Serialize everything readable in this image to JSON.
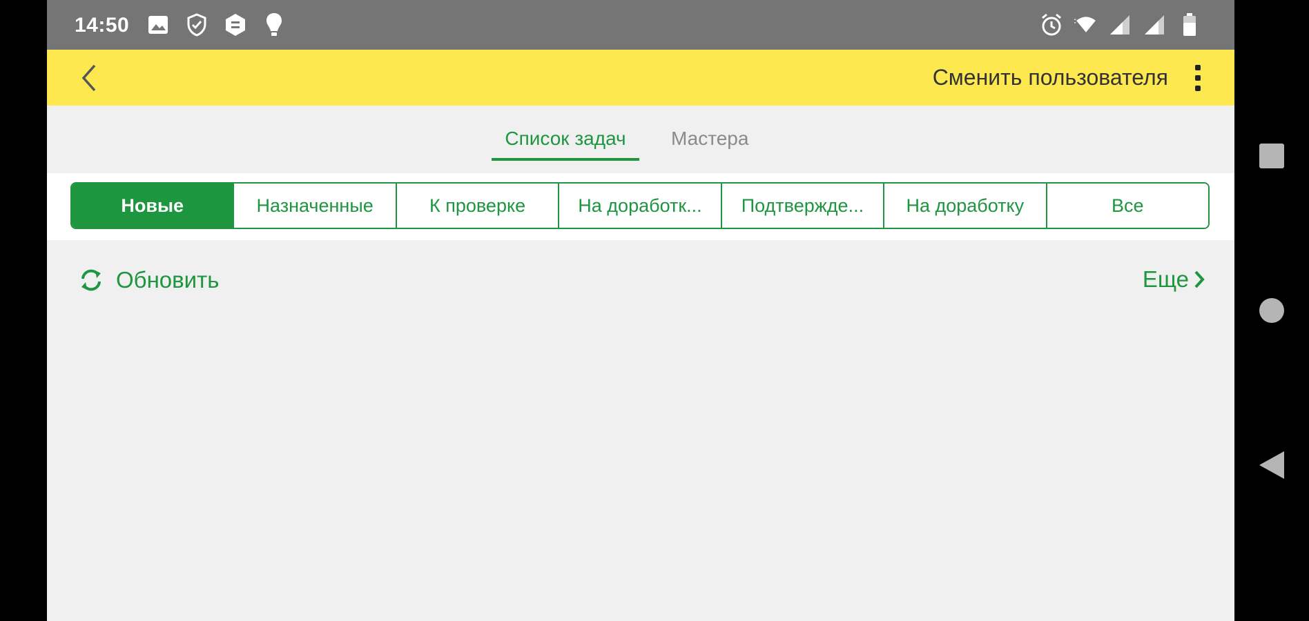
{
  "status_bar": {
    "time": "14:50",
    "left_icons": [
      "image-icon",
      "shield-check-icon",
      "hexagon-icon",
      "bulb-icon"
    ],
    "right_icons": [
      "alarm-icon",
      "wifi-icon",
      "signal-icon",
      "signal-icon",
      "battery-icon"
    ]
  },
  "app_bar": {
    "switch_user_label": "Сменить пользователя"
  },
  "tabs": [
    {
      "label": "Список задач",
      "active": true
    },
    {
      "label": "Мастера",
      "active": false
    }
  ],
  "filters": [
    {
      "label": "Новые",
      "active": true
    },
    {
      "label": "Назначенные",
      "active": false
    },
    {
      "label": "К проверке",
      "active": false
    },
    {
      "label": "На доработк...",
      "active": false
    },
    {
      "label": "Подтвержде...",
      "active": false
    },
    {
      "label": "На доработку",
      "active": false
    },
    {
      "label": "Все",
      "active": false
    }
  ],
  "actions": {
    "refresh_label": "Обновить",
    "more_label": "Еще"
  },
  "colors": {
    "accent": "#1e9640",
    "app_bar": "#fde84f",
    "status_bar": "#757575",
    "background": "#f0f0f0"
  }
}
